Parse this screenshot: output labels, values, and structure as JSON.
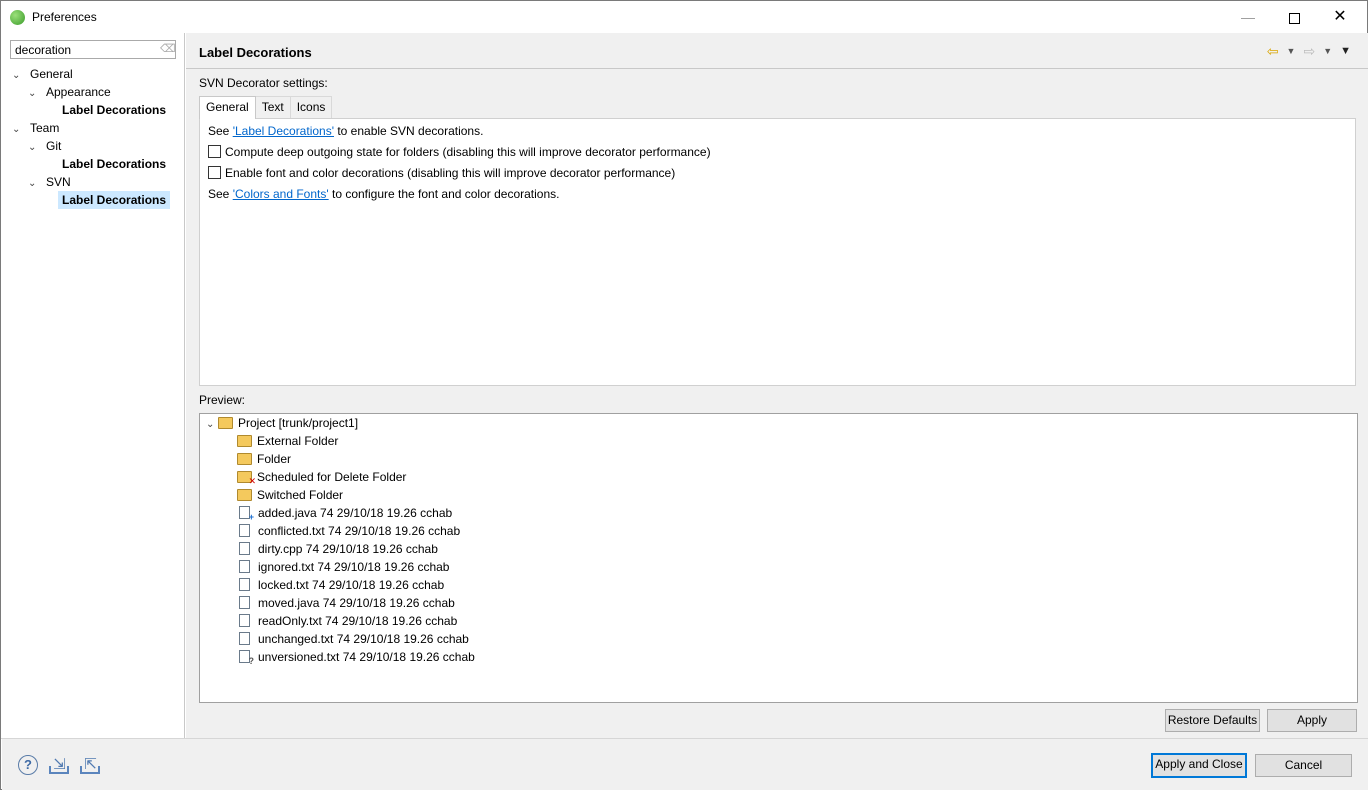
{
  "window": {
    "title": "Preferences",
    "minimize": "—",
    "close": "✕"
  },
  "filter": {
    "value": "decoration"
  },
  "tree": [
    {
      "label": "General",
      "level": 0,
      "chev": "⌄",
      "bold": false
    },
    {
      "label": "Appearance",
      "level": 1,
      "chev": "⌄",
      "bold": false
    },
    {
      "label": "Label Decorations",
      "level": 2,
      "chev": "",
      "bold": true
    },
    {
      "label": "Team",
      "level": 0,
      "chev": "⌄",
      "bold": false
    },
    {
      "label": "Git",
      "level": 1,
      "chev": "⌄",
      "bold": false
    },
    {
      "label": "Label Decorations",
      "level": 2,
      "chev": "",
      "bold": true
    },
    {
      "label": "SVN",
      "level": 1,
      "chev": "⌄",
      "bold": false
    },
    {
      "label": "Label Decorations",
      "level": 2,
      "chev": "",
      "bold": true,
      "selected": true
    }
  ],
  "page": {
    "title": "Label Decorations",
    "settings_label": "SVN Decorator settings:",
    "tabs": [
      "General",
      "Text",
      "Icons"
    ],
    "line1_pre": "See ",
    "line1_link": "'Label Decorations'",
    "line1_post": " to enable SVN decorations.",
    "checkbox1": "Compute deep outgoing state for folders (disabling this will improve decorator performance)",
    "checkbox2": "Enable font and color decorations (disabling this will improve decorator performance)",
    "line4_pre": "See ",
    "line4_link": "'Colors and Fonts'",
    "line4_post": " to configure the font and color decorations.",
    "preview_label": "Preview:"
  },
  "preview": {
    "project": "Project [trunk/project1]",
    "items": [
      {
        "label": "External Folder",
        "kind": "folder",
        "overlay": ""
      },
      {
        "label": "Folder",
        "kind": "folder",
        "overlay": ""
      },
      {
        "label": "Scheduled for Delete Folder",
        "kind": "folder",
        "overlay": "✕"
      },
      {
        "label": "Switched Folder",
        "kind": "folder",
        "overlay": ""
      },
      {
        "label": "added.java 74  29/10/18 19.26  cchab",
        "kind": "file",
        "overlay": "+"
      },
      {
        "label": "conflicted.txt 74  29/10/18 19.26  cchab",
        "kind": "file",
        "overlay": ""
      },
      {
        "label": "dirty.cpp 74  29/10/18 19.26  cchab",
        "kind": "file",
        "overlay": ""
      },
      {
        "label": "ignored.txt 74  29/10/18 19.26  cchab",
        "kind": "file",
        "overlay": ""
      },
      {
        "label": "locked.txt 74  29/10/18 19.26  cchab",
        "kind": "file",
        "overlay": ""
      },
      {
        "label": "moved.java 74  29/10/18 19.26  cchab",
        "kind": "file",
        "overlay": ""
      },
      {
        "label": "readOnly.txt 74  29/10/18 19.26  cchab",
        "kind": "file",
        "overlay": ""
      },
      {
        "label": "unchanged.txt 74  29/10/18 19.26  cchab",
        "kind": "file",
        "overlay": ""
      },
      {
        "label": "unversioned.txt 74  29/10/18 19.26  cchab",
        "kind": "file",
        "overlay": "?"
      }
    ]
  },
  "buttons": {
    "restore_defaults": "Restore Defaults",
    "apply": "Apply",
    "apply_and_close": "Apply and Close",
    "cancel": "Cancel"
  },
  "colors": {
    "accent": "#0078d7",
    "selection": "#cce8ff",
    "link": "#0066cc"
  }
}
